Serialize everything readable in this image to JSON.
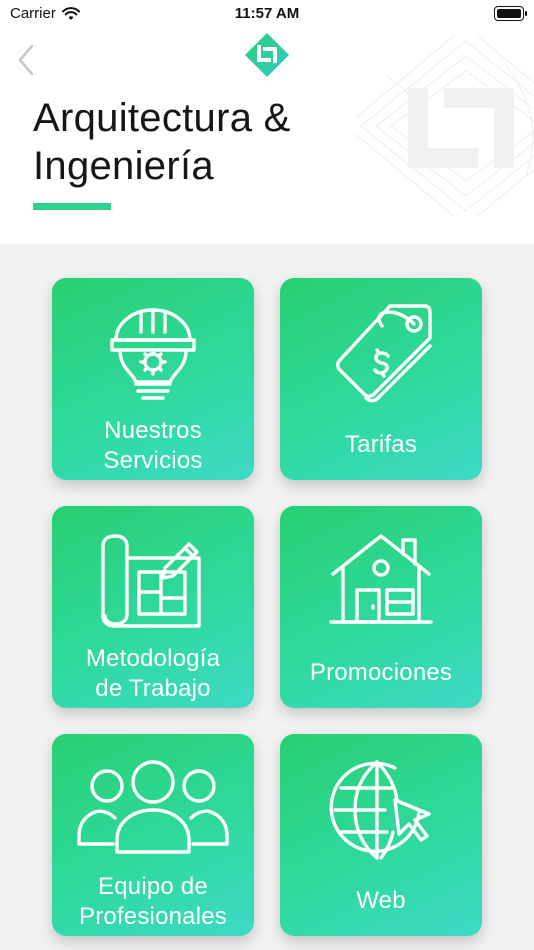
{
  "status_bar": {
    "carrier": "Carrier",
    "time": "11:57 AM"
  },
  "header": {
    "title_line1": "Arquitectura &",
    "title_line2": "Ingeniería",
    "accent_color": "#2fd18e"
  },
  "tiles": [
    {
      "line1": "Nuestros",
      "line2": "Servicios",
      "icon": "helmet-bulb-icon"
    },
    {
      "line1": "Tarifas",
      "line2": "",
      "icon": "price-tag-icon"
    },
    {
      "line1": "Metodología",
      "line2": "de Trabajo",
      "icon": "blueprint-icon"
    },
    {
      "line1": "Promociones",
      "line2": "",
      "icon": "house-icon"
    },
    {
      "line1": "Equipo de",
      "line2": "Profesionales",
      "icon": "team-icon"
    },
    {
      "line1": "Web",
      "line2": "",
      "icon": "globe-cursor-icon"
    }
  ],
  "colors": {
    "tile_gradient_start": "#27d071",
    "tile_gradient_end": "#3ddac6",
    "background": "#f2f2f2"
  }
}
